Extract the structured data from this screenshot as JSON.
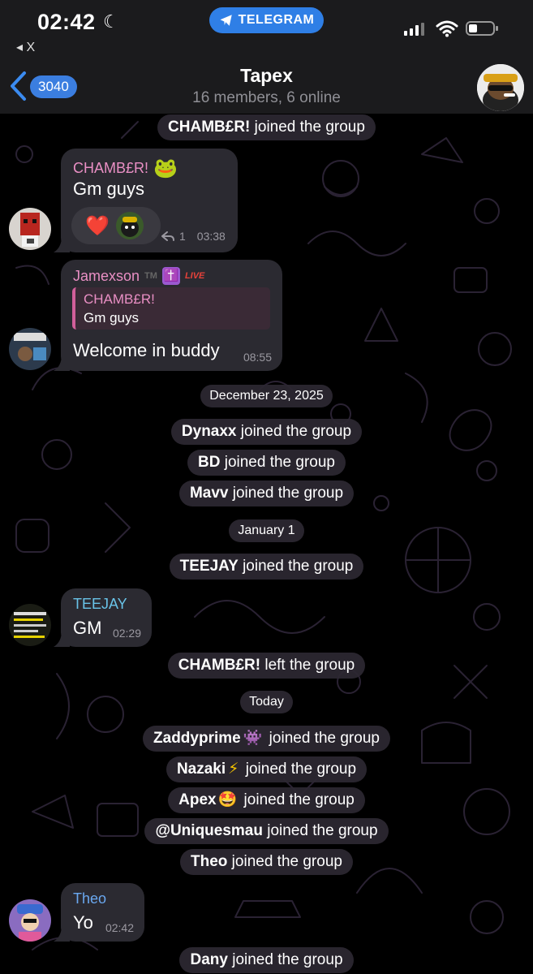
{
  "status_bar": {
    "time": "02:42",
    "back_app": "◂ X",
    "center_app": "TELEGRAM",
    "battery_level": 0.35
  },
  "header": {
    "unread_count": "3040",
    "title": "Tapex",
    "subtitle": "16 members, 6 online"
  },
  "messages": {
    "sys_chamber_join": {
      "name": "CHAMB£R!",
      "text": " joined the group"
    },
    "msg1": {
      "sender": "CHAMB£R!",
      "sender_emoji": "🐸",
      "text": "Gm guys",
      "reaction": "❤️",
      "reply_count": "1",
      "time": "03:38"
    },
    "msg2": {
      "sender": "Jamexson",
      "sender_badge": "TM",
      "sender_emoji": "✝️",
      "live_label": "LIVE",
      "quote_sender": "CHAMB£R!",
      "quote_text": "Gm guys",
      "text": "Welcome in buddy",
      "time": "08:55"
    },
    "date1": "December 23, 2025",
    "sys_dynaxx": {
      "name": "Dynaxx",
      "text": " joined the group"
    },
    "sys_bd": {
      "name": "BD",
      "text": " joined the group"
    },
    "sys_mavv": {
      "name": "Mavv",
      "text": " joined the group"
    },
    "date2": "January 1",
    "sys_teejay": {
      "name": "TEEJAY",
      "text": " joined the group"
    },
    "msg3": {
      "sender": "TEEJAY",
      "text": "GM",
      "time": "02:29"
    },
    "sys_chamber_left": {
      "name": "CHAMB£R!",
      "text": " left the group"
    },
    "date3": "Today",
    "sys_zaddy": {
      "name": "Zaddyprime",
      "emoji": "👾",
      "text": " joined the group"
    },
    "sys_nazaki": {
      "name": "Nazaki",
      "emoji": "⚡",
      "text": " joined the group"
    },
    "sys_apex": {
      "name": "Apex",
      "emoji": "🤩",
      "text": " joined the group"
    },
    "sys_unique": {
      "name": "@Uniquesmau",
      "text": " joined the group"
    },
    "sys_theo": {
      "name": "Theo",
      "text": " joined the group"
    },
    "msg4": {
      "sender": "Theo",
      "text": "Yo",
      "time": "02:42"
    },
    "sys_dany": {
      "name": "Dany",
      "text": " joined the group"
    }
  },
  "colors": {
    "chamber_name": "#e98fc4",
    "jamexson_name": "#e98fc4",
    "teejay_name": "#69c3e8",
    "theo_name": "#6aa8f0",
    "bubble": "#2b2a31",
    "accent": "#3b7ee0",
    "live": "#e8423a"
  }
}
